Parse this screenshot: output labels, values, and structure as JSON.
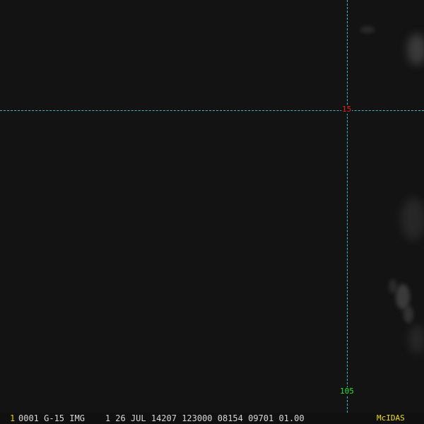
{
  "colors": {
    "background": "#121212",
    "gridline": "#3fb8c8",
    "latitude_label": "#e02020",
    "longitude_label": "#30e030",
    "frame_number": "#f0d000",
    "status_text": "#d8d8d8",
    "brand": "#f0e000"
  },
  "map": {
    "latitude_label": "15",
    "longitude_label": "105"
  },
  "status_bar": {
    "frame_number": "1",
    "text": "0001 G-15 IMG    1 26 JUL 14207 123000 08154 09701 01.00",
    "brand": "McIDAS"
  }
}
